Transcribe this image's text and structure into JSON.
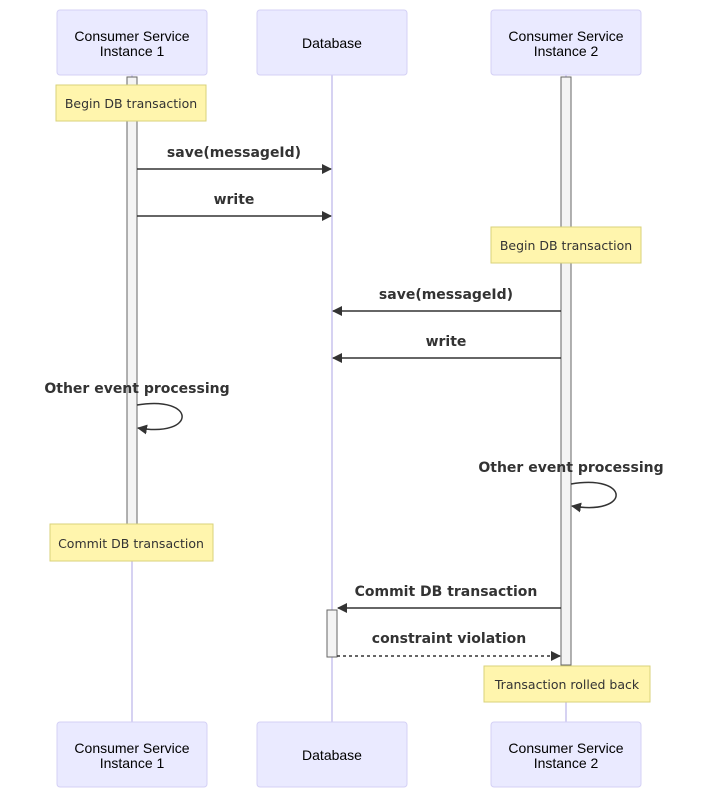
{
  "participants": [
    {
      "line1": "Consumer Service",
      "line2": "Instance 1"
    },
    {
      "line1": "Database",
      "line2": ""
    },
    {
      "line1": "Consumer Service",
      "line2": "Instance 2"
    }
  ],
  "notes": [
    {
      "text": "Begin DB transaction",
      "over": "Consumer Service Instance 1"
    },
    {
      "text": "Begin DB transaction",
      "over": "Consumer Service Instance 2"
    },
    {
      "text": "Commit DB transaction",
      "over": "Consumer Service Instance 1"
    },
    {
      "text": "Transaction rolled back",
      "over": "Consumer Service Instance 2"
    }
  ],
  "messages": [
    {
      "label": "save(messageId)",
      "from": "Consumer Service Instance 1",
      "to": "Database",
      "style": "solid"
    },
    {
      "label": "write",
      "from": "Consumer Service Instance 1",
      "to": "Database",
      "style": "solid"
    },
    {
      "label": "save(messageId)",
      "from": "Consumer Service Instance 2",
      "to": "Database",
      "style": "solid"
    },
    {
      "label": "write",
      "from": "Consumer Service Instance 2",
      "to": "Database",
      "style": "solid"
    },
    {
      "label": "Other event processing",
      "from": "Consumer Service Instance 1",
      "to": "Consumer Service Instance 1",
      "style": "solid"
    },
    {
      "label": "Other event processing",
      "from": "Consumer Service Instance 2",
      "to": "Consumer Service Instance 2",
      "style": "solid"
    },
    {
      "label": "Commit DB transaction",
      "from": "Consumer Service Instance 2",
      "to": "Database",
      "style": "solid"
    },
    {
      "label": "constraint violation",
      "from": "Database",
      "to": "Consumer Service Instance 2",
      "style": "dashed"
    }
  ],
  "colors": {
    "actor_fill": "#eaeaff",
    "note_fill": "#fff5ad",
    "lifeline": "#c9c4ee",
    "arrow": "#333333"
  }
}
